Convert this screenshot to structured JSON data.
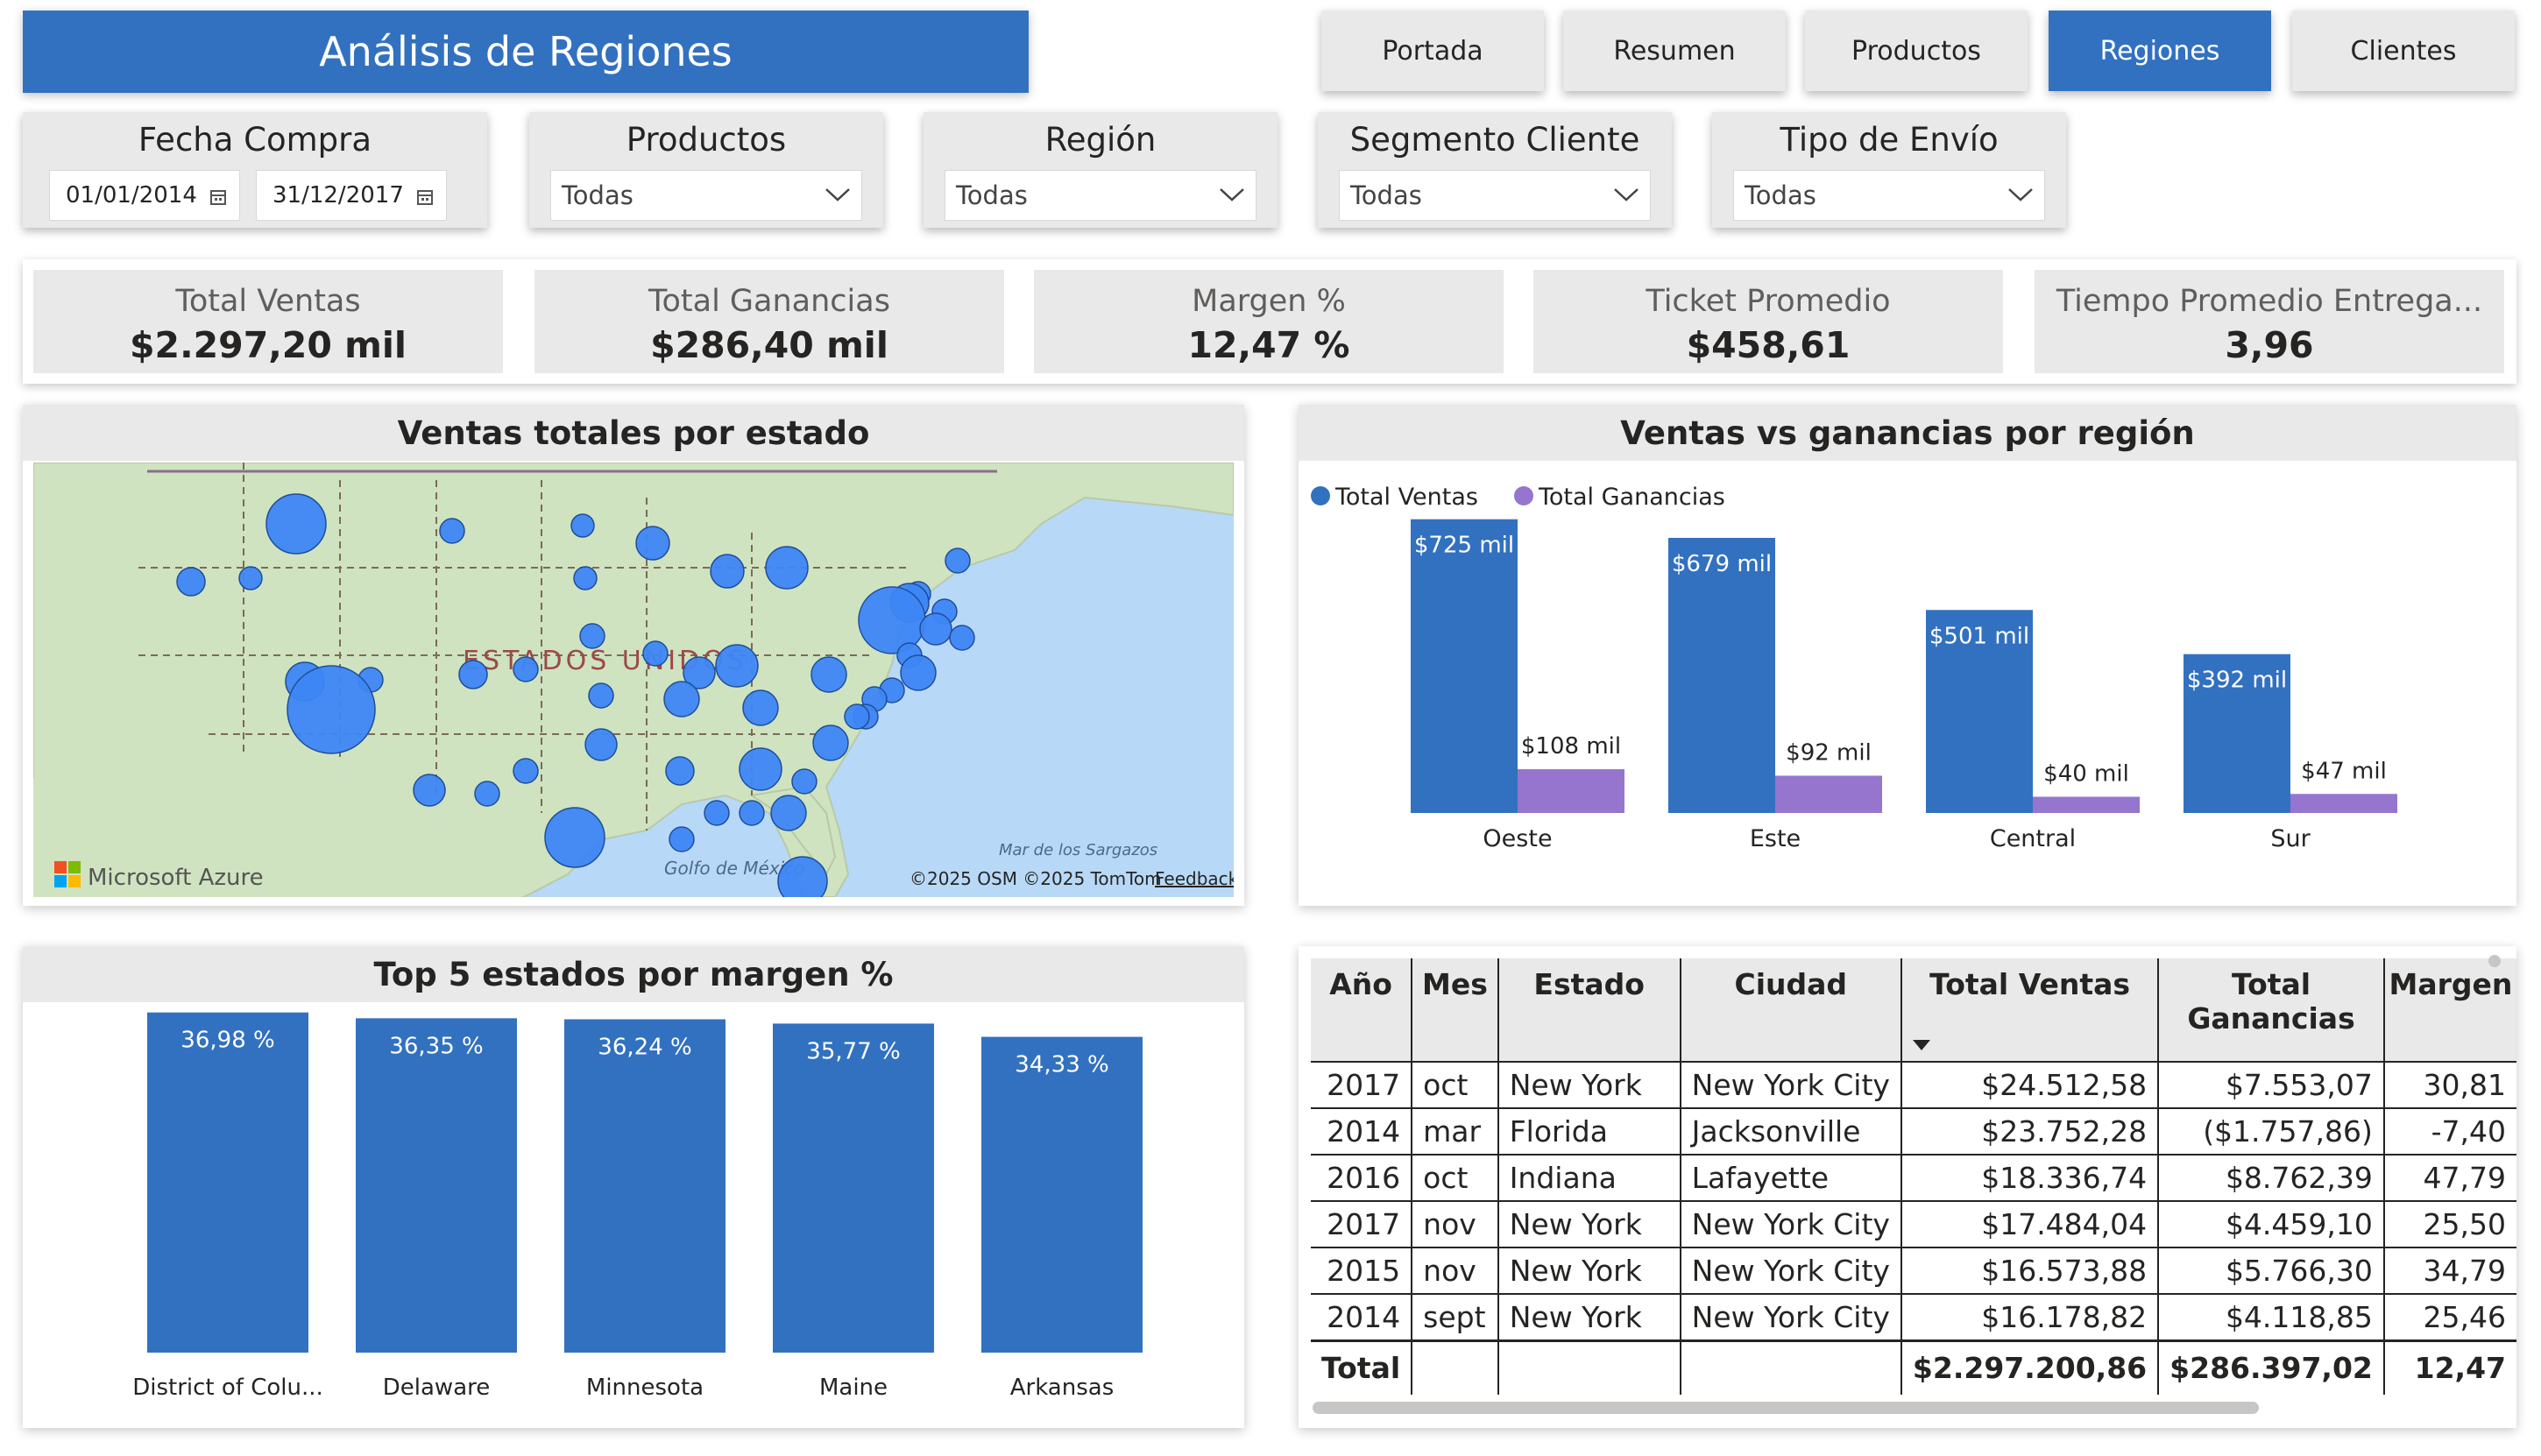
{
  "page": {
    "title": "Análisis de Regiones"
  },
  "nav": [
    {
      "label": "Portada",
      "active": false
    },
    {
      "label": "Resumen",
      "active": false
    },
    {
      "label": "Productos",
      "active": false
    },
    {
      "label": "Regiones",
      "active": true
    },
    {
      "label": "Clientes",
      "active": false
    }
  ],
  "slicers": {
    "fecha": {
      "title": "Fecha Compra",
      "from": "01/01/2014",
      "to": "31/12/2017"
    },
    "productos": {
      "title": "Productos",
      "value": "Todas"
    },
    "region": {
      "title": "Región",
      "value": "Todas"
    },
    "segmento": {
      "title": "Segmento Cliente",
      "value": "Todas"
    },
    "envio": {
      "title": "Tipo de Envío",
      "value": "Todas"
    }
  },
  "kpis": [
    {
      "label": "Total Ventas",
      "value": "$2.297,20 mil"
    },
    {
      "label": "Total Ganancias",
      "value": "$286,40 mil"
    },
    {
      "label": "Margen %",
      "value": "12,47 %"
    },
    {
      "label": "Ticket Promedio",
      "value": "$458,61"
    },
    {
      "label": "Tiempo Promedio Entrega...",
      "value": "3,96"
    }
  ],
  "map": {
    "title": "Ventas totales por estado",
    "country_label": "ESTADOS UNIDOS",
    "gulf_label": "Golfo de México",
    "sea_label": "Mar de los Sargazos",
    "brand": "Microsoft Azure",
    "attribution": "©2025 OSM  ©2025 TomTom",
    "feedback": "Feedback",
    "colors": {
      "water": "#b7d9f7",
      "land": "#cfe3c0",
      "bubble": "#3d86f5"
    }
  },
  "charts": {
    "region_chart": {
      "title": "Ventas vs ganancias por región",
      "chart_data": {
        "type": "bar",
        "categories": [
          "Oeste",
          "Este",
          "Central",
          "Sur"
        ],
        "series": [
          {
            "name": "Total Ventas",
            "values": [
              725,
              679,
              501,
              392
            ],
            "labels": [
              "$725 mil",
              "$679 mil",
              "$501 mil",
              "$392 mil"
            ],
            "color": "#3271c0"
          },
          {
            "name": "Total Ganancias",
            "values": [
              108,
              92,
              40,
              47
            ],
            "labels": [
              "$108 mil",
              "$92 mil",
              "$40 mil",
              "$47 mil"
            ],
            "color": "#9575cd"
          }
        ],
        "ylim": [
          0,
          800
        ],
        "legend": "top-left"
      }
    },
    "top5_chart": {
      "title": "Top 5 estados por margen %",
      "chart_data": {
        "type": "bar",
        "categories": [
          "District of Colu...",
          "Delaware",
          "Minnesota",
          "Maine",
          "Arkansas"
        ],
        "values": [
          36.98,
          36.35,
          36.24,
          35.77,
          34.33
        ],
        "labels": [
          "36,98 %",
          "36,35 %",
          "36,24 %",
          "35,77 %",
          "34,33 %"
        ],
        "ylim": [
          0,
          40
        ],
        "color": "#3271c0"
      }
    }
  },
  "table": {
    "headers": [
      "Año",
      "Mes",
      "Estado",
      "Ciudad",
      "Total Ventas",
      "Total Ganancias",
      "Margen"
    ],
    "rows": [
      [
        "2017",
        "oct",
        "New York",
        "New York City",
        "$24.512,58",
        "$7.553,07",
        "30,81"
      ],
      [
        "2014",
        "mar",
        "Florida",
        "Jacksonville",
        "$23.752,28",
        "($1.757,86)",
        "-7,40"
      ],
      [
        "2016",
        "oct",
        "Indiana",
        "Lafayette",
        "$18.336,74",
        "$8.762,39",
        "47,79"
      ],
      [
        "2017",
        "nov",
        "New York",
        "New York City",
        "$17.484,04",
        "$4.459,10",
        "25,50"
      ],
      [
        "2015",
        "nov",
        "New York",
        "New York City",
        "$16.573,88",
        "$5.766,30",
        "34,79"
      ],
      [
        "2014",
        "sept",
        "New York",
        "New York City",
        "$16.178,82",
        "$4.118,85",
        "25,46"
      ]
    ],
    "total": [
      "Total",
      "",
      "",
      "",
      "$2.297.200,86",
      "$286.397,02",
      "12,47"
    ]
  }
}
